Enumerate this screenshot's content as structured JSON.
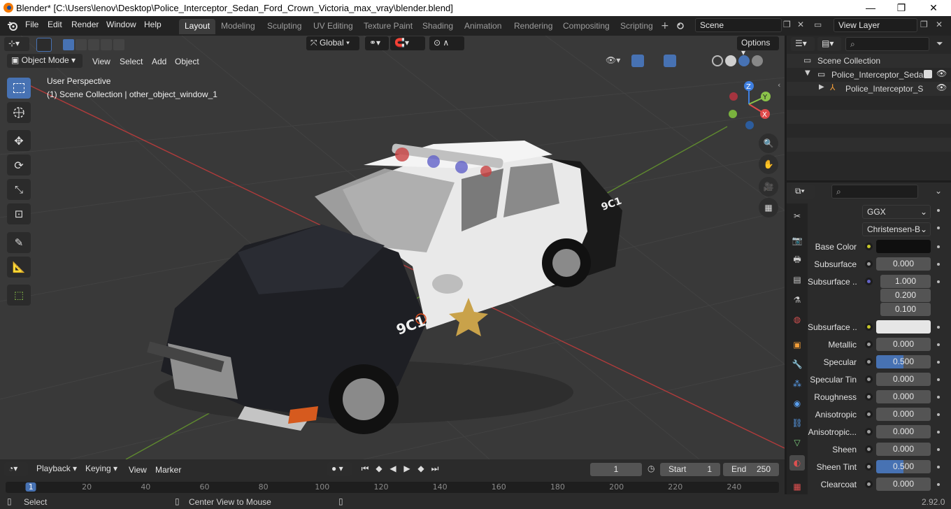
{
  "window": {
    "title": "Blender* [C:\\Users\\lenov\\Desktop\\Police_Interceptor_Sedan_Ford_Crown_Victoria_max_vray\\blender.blend]",
    "minimize": "—",
    "maximize": "❐",
    "close": "✕"
  },
  "menus": [
    "File",
    "Edit",
    "Render",
    "Window",
    "Help"
  ],
  "workspace_tabs": [
    "Layout",
    "Modeling",
    "Sculpting",
    "UV Editing",
    "Texture Paint",
    "Shading",
    "Animation",
    "Rendering",
    "Compositing",
    "Scripting"
  ],
  "active_tab": "Layout",
  "scene": {
    "label": "Scene",
    "view_layer": "View Layer"
  },
  "viewport": {
    "transform_orientation": "Global",
    "options": "Options",
    "mode": "Object Mode",
    "header_menus": [
      "View",
      "Select",
      "Add",
      "Object"
    ],
    "perspective": "User Perspective",
    "collection_info": "(1) Scene Collection | other_object_window_1",
    "gizmo": {
      "x": "X",
      "y": "Y",
      "z": "Z"
    }
  },
  "car": {
    "hood_number": "9C1",
    "roof_number": "9C1"
  },
  "outliner": {
    "root": "Scene Collection",
    "items": [
      {
        "label": "Police_Interceptor_Sedan",
        "type": "collection"
      },
      {
        "label": "Police_Interceptor_S",
        "type": "object"
      }
    ]
  },
  "properties": {
    "distribution": "GGX",
    "subsurface_method": "Christensen-B...",
    "rows": [
      {
        "label": "Base Color",
        "value": "",
        "kind": "color",
        "color": "#0f0f0f",
        "dot": "yellow"
      },
      {
        "label": "Subsurface",
        "value": "0.000",
        "kind": "num",
        "dot": "grey"
      },
      {
        "label": "Subsurface ...",
        "value": "1.000",
        "kind": "vec",
        "dot": "blue",
        "extra": [
          "0.200",
          "0.100"
        ]
      },
      {
        "label": "Subsurface ...",
        "value": "",
        "kind": "color",
        "color": "#e6e6e6",
        "dot": "yellow"
      },
      {
        "label": "Metallic",
        "value": "0.000",
        "kind": "num",
        "dot": "grey"
      },
      {
        "label": "Specular",
        "value": "0.500",
        "kind": "num",
        "fill": 0.5,
        "dot": "grey"
      },
      {
        "label": "Specular Tin",
        "value": "0.000",
        "kind": "num",
        "dot": "grey"
      },
      {
        "label": "Roughness",
        "value": "0.000",
        "kind": "num",
        "dot": "grey"
      },
      {
        "label": "Anisotropic",
        "value": "0.000",
        "kind": "num",
        "dot": "grey"
      },
      {
        "label": "Anisotropic...",
        "value": "0.000",
        "kind": "num",
        "dot": "grey"
      },
      {
        "label": "Sheen",
        "value": "0.000",
        "kind": "num",
        "dot": "grey"
      },
      {
        "label": "Sheen Tint",
        "value": "0.500",
        "kind": "num",
        "fill": 0.5,
        "dot": "grey"
      },
      {
        "label": "Clearcoat",
        "value": "0.000",
        "kind": "num",
        "dot": "grey"
      }
    ]
  },
  "timeline": {
    "menus": [
      "Playback",
      "Keying",
      "View",
      "Marker"
    ],
    "current_frame": "1",
    "start_label": "Start",
    "start": "1",
    "end_label": "End",
    "end": "250",
    "ruler": [
      "1",
      "20",
      "40",
      "60",
      "80",
      "100",
      "120",
      "140",
      "160",
      "180",
      "200",
      "220",
      "240"
    ]
  },
  "status": {
    "select": "Select",
    "center": "Center View to Mouse",
    "version": "2.92.0"
  },
  "colors": {
    "accent": "#4772b3",
    "x_axis": "#e04a4a",
    "y_axis": "#8bc34a",
    "z_axis": "#3f7fe0"
  }
}
